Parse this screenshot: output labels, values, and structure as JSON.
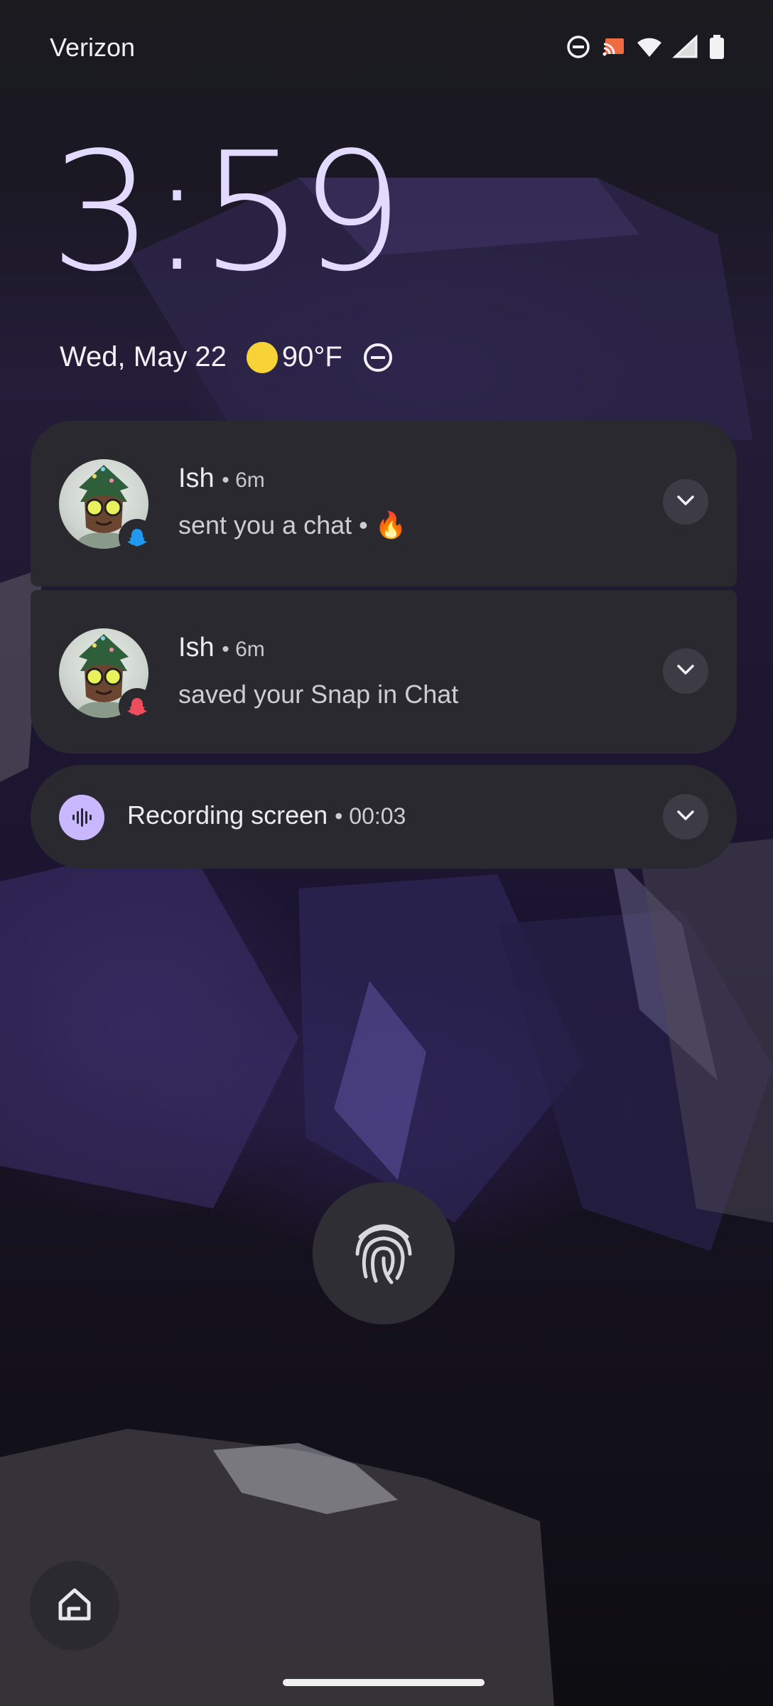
{
  "status_bar": {
    "carrier": "Verizon",
    "icons": [
      "do-not-disturb-icon",
      "cast-icon",
      "wifi-icon",
      "cell-signal-icon",
      "battery-icon"
    ]
  },
  "lockscreen": {
    "time": "3:59",
    "date": "Wed, May 22",
    "weather": {
      "icon": "sun-icon",
      "temperature": "90°F"
    },
    "dnd_icon": "do-not-disturb-icon"
  },
  "notifications": [
    {
      "sender": "Ish",
      "time": "• 6m",
      "text": "sent you a chat • 🔥",
      "app": "snapchat",
      "badge_color": "#1e9bf0"
    },
    {
      "sender": "Ish",
      "time": "• 6m",
      "text": "saved your Snap in Chat",
      "app": "snapchat",
      "badge_color": "#ef4d5e"
    }
  ],
  "recording": {
    "label": "Recording screen",
    "duration": "• 00:03",
    "accent": "#c9b8ff"
  },
  "controls": {
    "fingerprint": "fingerprint-icon",
    "home": "home-icon"
  }
}
